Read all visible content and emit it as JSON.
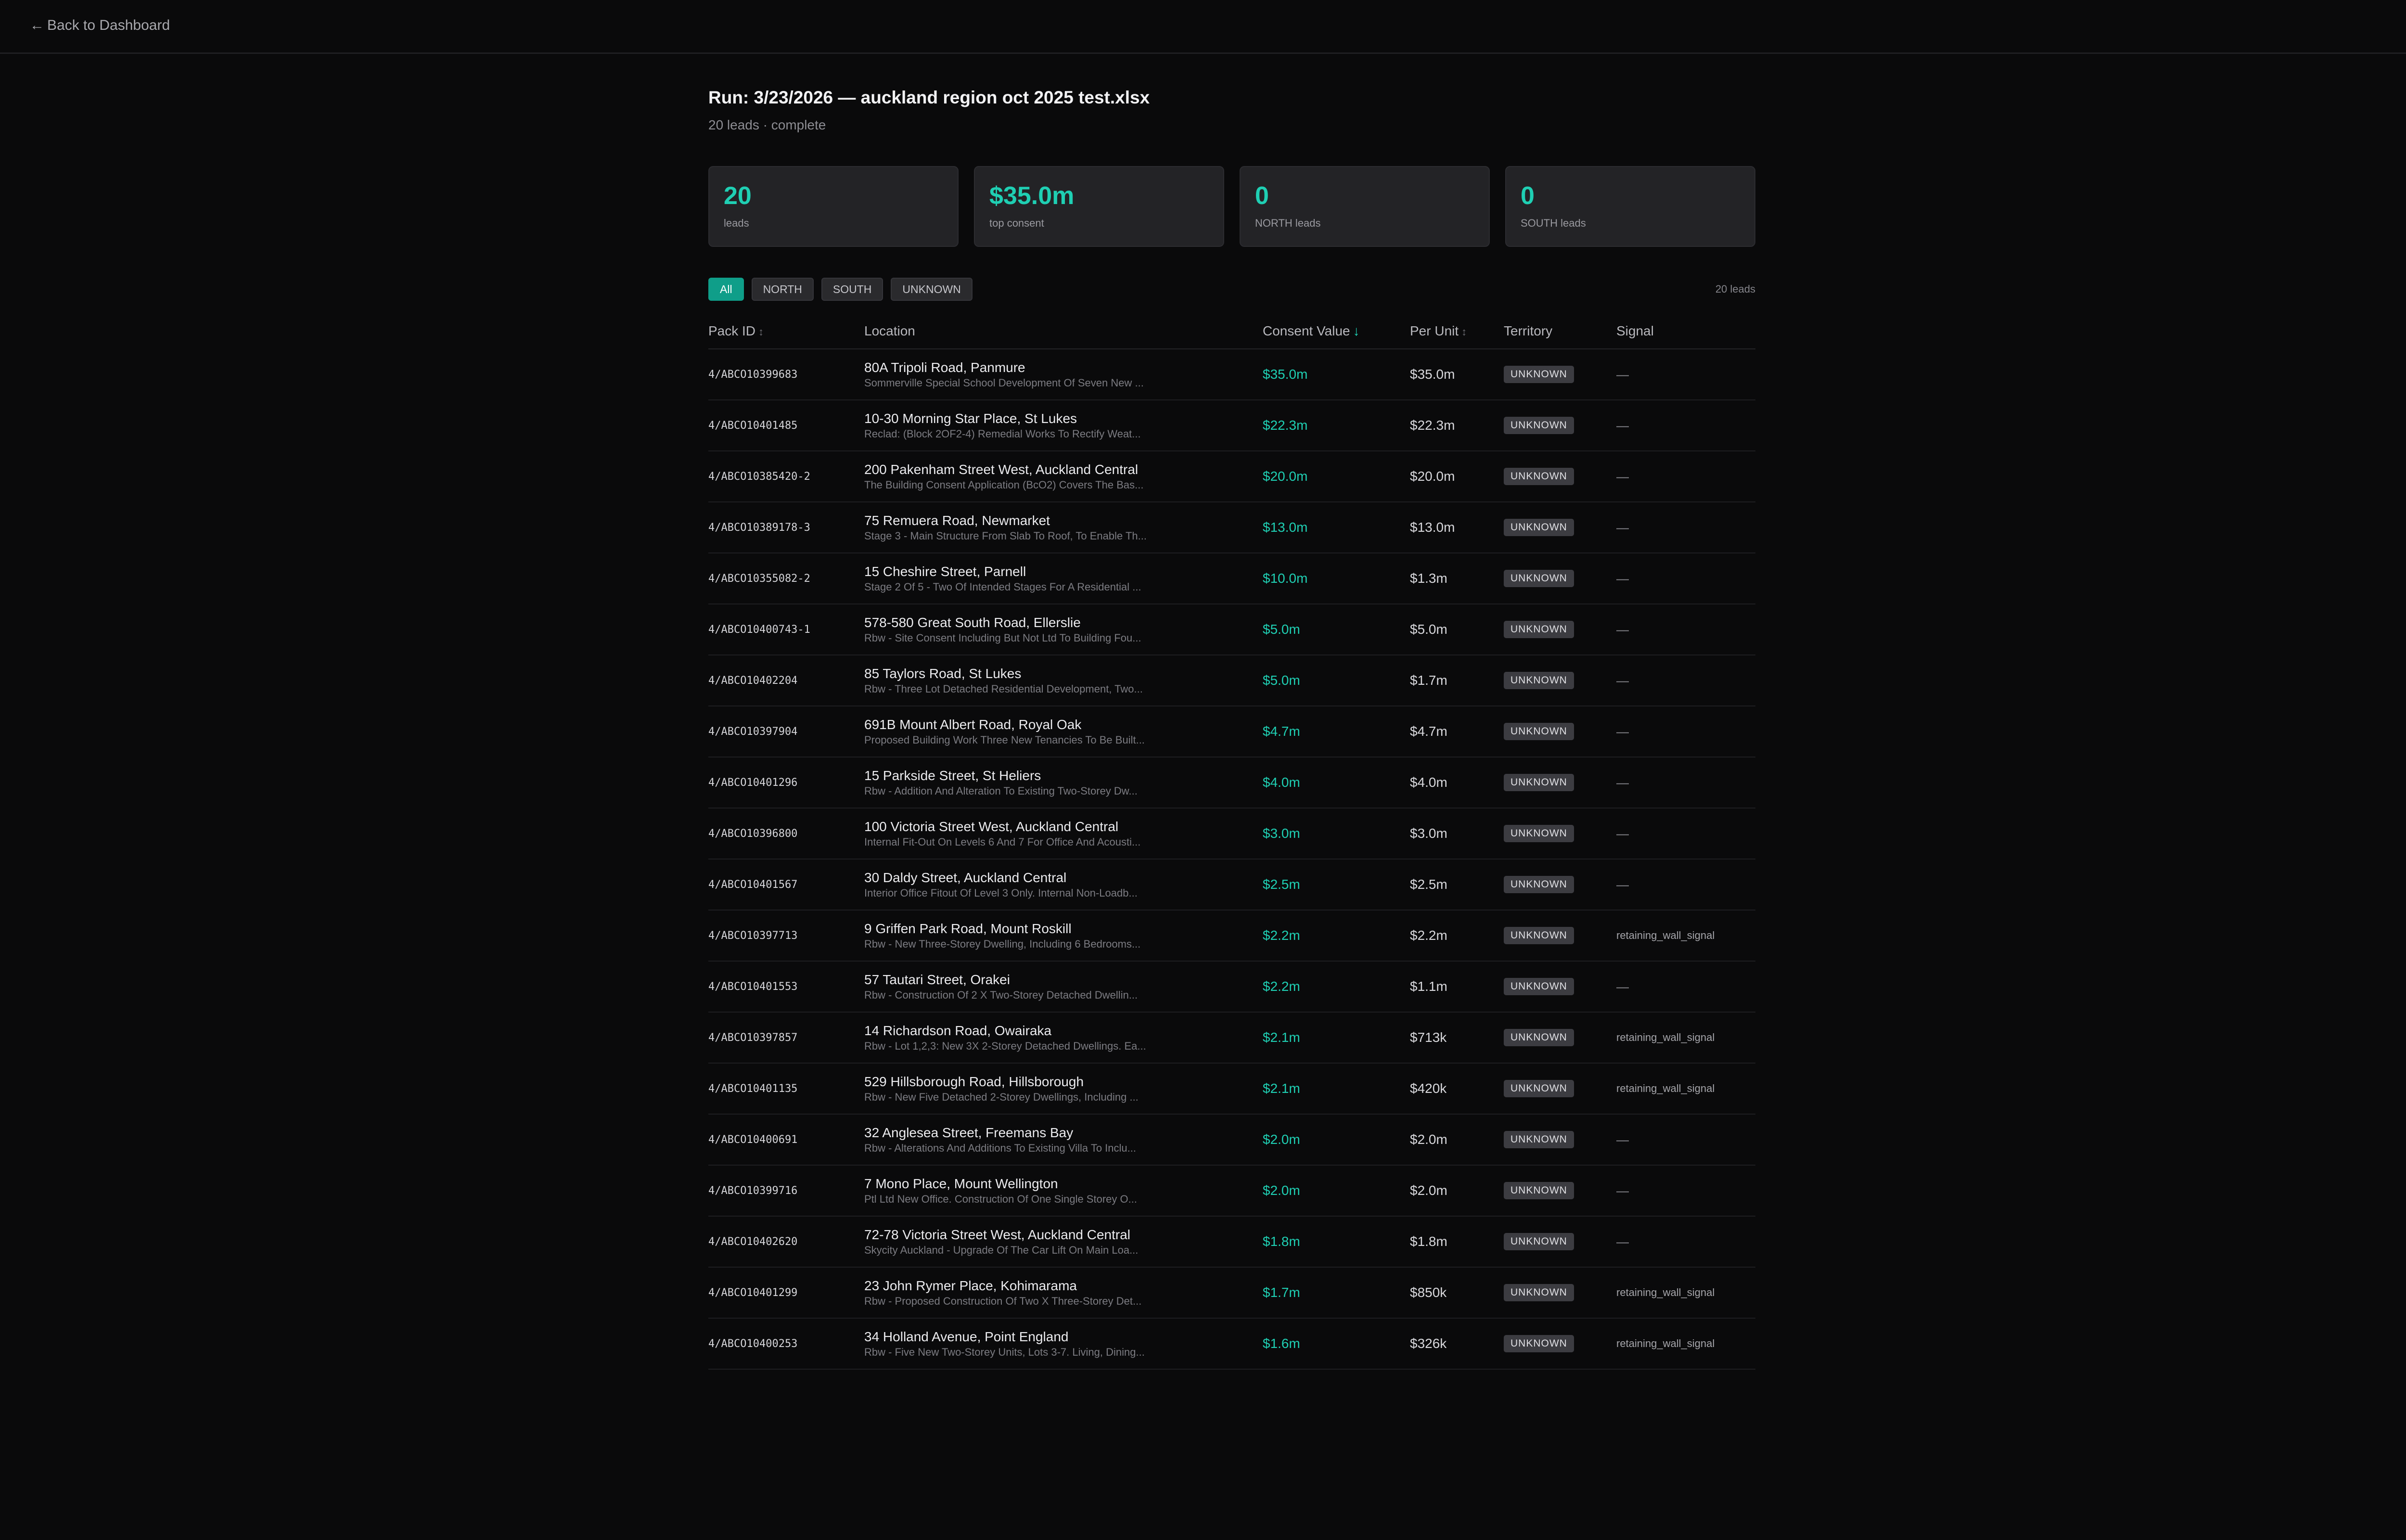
{
  "nav": {
    "back_arrow": "←",
    "back_label": "Back to Dashboard"
  },
  "header": {
    "title": "Run: 3/23/2026 — auckland region oct 2025 test.xlsx",
    "subtitle": "20 leads · complete"
  },
  "stats": [
    {
      "value": "20",
      "label": "leads"
    },
    {
      "value": "$35.0m",
      "label": "top consent"
    },
    {
      "value": "0",
      "label": "NORTH leads"
    },
    {
      "value": "0",
      "label": "SOUTH leads"
    }
  ],
  "filters": {
    "options": [
      "All",
      "NORTH",
      "SOUTH",
      "UNKNOWN"
    ],
    "selected": "All",
    "count_label": "20 leads"
  },
  "table": {
    "columns": {
      "pack_id": "Pack ID",
      "location": "Location",
      "consent_value": "Consent Value",
      "per_unit": "Per Unit",
      "territory": "Territory",
      "signal": "Signal"
    },
    "sort_icons": {
      "neutral": "↕",
      "active_desc": "↓"
    },
    "sorted_by": "consent_value",
    "rows": [
      {
        "pack_id": "4/ABCO10399683",
        "location": "80A Tripoli Road, Panmure",
        "description": "Sommerville Special School Development Of Seven New ...",
        "consent_value": "$35.0m",
        "per_unit": "$35.0m",
        "territory": "UNKNOWN",
        "signal": "—"
      },
      {
        "pack_id": "4/ABCO10401485",
        "location": "10-30 Morning Star Place, St Lukes",
        "description": "Reclad: (Block 2OF2-4) Remedial Works To Rectify Weat...",
        "consent_value": "$22.3m",
        "per_unit": "$22.3m",
        "territory": "UNKNOWN",
        "signal": "—"
      },
      {
        "pack_id": "4/ABCO10385420-2",
        "location": "200 Pakenham Street West, Auckland Central",
        "description": "The Building Consent Application (BcO2) Covers The Bas...",
        "consent_value": "$20.0m",
        "per_unit": "$20.0m",
        "territory": "UNKNOWN",
        "signal": "—"
      },
      {
        "pack_id": "4/ABCO10389178-3",
        "location": "75 Remuera Road, Newmarket",
        "description": "Stage 3 - Main Structure From Slab To Roof, To Enable Th...",
        "consent_value": "$13.0m",
        "per_unit": "$13.0m",
        "territory": "UNKNOWN",
        "signal": "—"
      },
      {
        "pack_id": "4/ABCO10355082-2",
        "location": "15 Cheshire Street, Parnell",
        "description": "Stage 2 Of 5 - Two Of Intended Stages For A Residential ...",
        "consent_value": "$10.0m",
        "per_unit": "$1.3m",
        "territory": "UNKNOWN",
        "signal": "—"
      },
      {
        "pack_id": "4/ABCO10400743-1",
        "location": "578-580 Great South Road, Ellerslie",
        "description": "Rbw - Site Consent Including But Not Ltd To Building Fou...",
        "consent_value": "$5.0m",
        "per_unit": "$5.0m",
        "territory": "UNKNOWN",
        "signal": "—"
      },
      {
        "pack_id": "4/ABCO10402204",
        "location": "85 Taylors Road, St Lukes",
        "description": "Rbw - Three Lot Detached Residential Development, Two...",
        "consent_value": "$5.0m",
        "per_unit": "$1.7m",
        "territory": "UNKNOWN",
        "signal": "—"
      },
      {
        "pack_id": "4/ABCO10397904",
        "location": "691B Mount Albert Road, Royal Oak",
        "description": "Proposed Building Work Three New Tenancies To Be Built...",
        "consent_value": "$4.7m",
        "per_unit": "$4.7m",
        "territory": "UNKNOWN",
        "signal": "—"
      },
      {
        "pack_id": "4/ABCO10401296",
        "location": "15 Parkside Street, St Heliers",
        "description": "Rbw - Addition And Alteration To Existing Two-Storey Dw...",
        "consent_value": "$4.0m",
        "per_unit": "$4.0m",
        "territory": "UNKNOWN",
        "signal": "—"
      },
      {
        "pack_id": "4/ABCO10396800",
        "location": "100 Victoria Street West, Auckland Central",
        "description": "Internal Fit-Out On Levels 6 And 7 For Office And Acousti...",
        "consent_value": "$3.0m",
        "per_unit": "$3.0m",
        "territory": "UNKNOWN",
        "signal": "—"
      },
      {
        "pack_id": "4/ABCO10401567",
        "location": "30 Daldy Street, Auckland Central",
        "description": "Interior Office Fitout Of Level 3 Only. Internal Non-Loadb...",
        "consent_value": "$2.5m",
        "per_unit": "$2.5m",
        "territory": "UNKNOWN",
        "signal": "—"
      },
      {
        "pack_id": "4/ABCO10397713",
        "location": "9 Griffen Park Road, Mount Roskill",
        "description": "Rbw - New Three-Storey Dwelling, Including 6 Bedrooms...",
        "consent_value": "$2.2m",
        "per_unit": "$2.2m",
        "territory": "UNKNOWN",
        "signal": "retaining_wall_signal"
      },
      {
        "pack_id": "4/ABCO10401553",
        "location": "57 Tautari Street, Orakei",
        "description": "Rbw - Construction Of 2 X Two-Storey Detached Dwellin...",
        "consent_value": "$2.2m",
        "per_unit": "$1.1m",
        "territory": "UNKNOWN",
        "signal": "—"
      },
      {
        "pack_id": "4/ABCO10397857",
        "location": "14 Richardson Road, Owairaka",
        "description": "Rbw - Lot 1,2,3: New 3X 2-Storey Detached Dwellings. Ea...",
        "consent_value": "$2.1m",
        "per_unit": "$713k",
        "territory": "UNKNOWN",
        "signal": "retaining_wall_signal"
      },
      {
        "pack_id": "4/ABCO10401135",
        "location": "529 Hillsborough Road, Hillsborough",
        "description": "Rbw - New Five Detached 2-Storey Dwellings, Including ...",
        "consent_value": "$2.1m",
        "per_unit": "$420k",
        "territory": "UNKNOWN",
        "signal": "retaining_wall_signal"
      },
      {
        "pack_id": "4/ABCO10400691",
        "location": "32 Anglesea Street, Freemans Bay",
        "description": "Rbw - Alterations And Additions To Existing Villa To Inclu...",
        "consent_value": "$2.0m",
        "per_unit": "$2.0m",
        "territory": "UNKNOWN",
        "signal": "—"
      },
      {
        "pack_id": "4/ABCO10399716",
        "location": "7 Mono Place, Mount Wellington",
        "description": "Ptl Ltd New Office. Construction Of One Single Storey O...",
        "consent_value": "$2.0m",
        "per_unit": "$2.0m",
        "territory": "UNKNOWN",
        "signal": "—"
      },
      {
        "pack_id": "4/ABCO10402620",
        "location": "72-78 Victoria Street West, Auckland Central",
        "description": "Skycity Auckland - Upgrade Of The Car Lift On Main Loa...",
        "consent_value": "$1.8m",
        "per_unit": "$1.8m",
        "territory": "UNKNOWN",
        "signal": "—"
      },
      {
        "pack_id": "4/ABCO10401299",
        "location": "23 John Rymer Place, Kohimarama",
        "description": "Rbw - Proposed Construction Of Two X Three-Storey Det...",
        "consent_value": "$1.7m",
        "per_unit": "$850k",
        "territory": "UNKNOWN",
        "signal": "retaining_wall_signal"
      },
      {
        "pack_id": "4/ABCO10400253",
        "location": "34 Holland Avenue, Point England",
        "description": "Rbw - Five New Two-Storey Units, Lots 3-7. Living, Dining...",
        "consent_value": "$1.6m",
        "per_unit": "$326k",
        "territory": "UNKNOWN",
        "signal": "retaining_wall_signal"
      }
    ]
  },
  "colors": {
    "background": "#0a0a0b",
    "accent": "#1fcfb3",
    "active_chip": "#0f9e89",
    "card": "#232326",
    "badge": "#3c3c41"
  }
}
